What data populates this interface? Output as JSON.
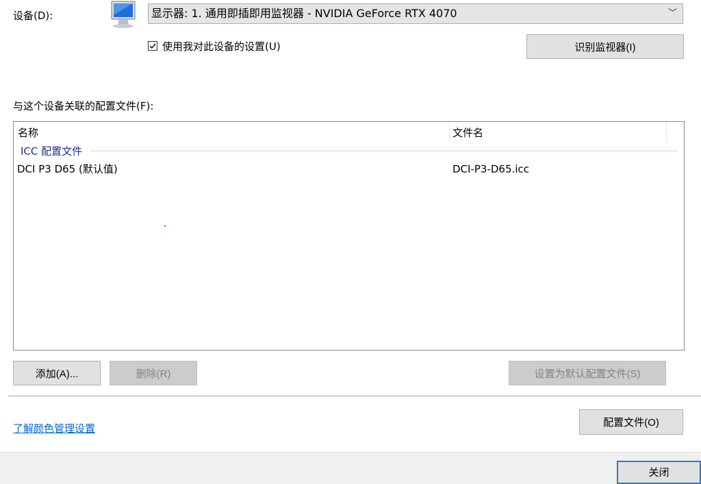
{
  "device": {
    "label": "设备(D):",
    "selected": "显示器: 1. 通用即插即用监视器 - NVIDIA GeForce RTX 4070"
  },
  "use_settings": {
    "label": "使用我对此设备的设置(U)",
    "checked": true
  },
  "identify_button": "识别监视器(I)",
  "profiles": {
    "label": "与这个设备关联的配置文件(F):",
    "columns": [
      "名称",
      "文件名"
    ],
    "group": "ICC 配置文件",
    "rows": [
      {
        "name": "DCI P3 D65 (默认值)",
        "file": "DCI-P3-D65.icc"
      }
    ]
  },
  "actions": {
    "add": "添加(A)...",
    "remove": "删除(R)",
    "set_default": "设置为默认配置文件(S)"
  },
  "learn_link": "了解颜色管理设置",
  "profile_button": "配置文件(O)",
  "close_button": "关闭"
}
